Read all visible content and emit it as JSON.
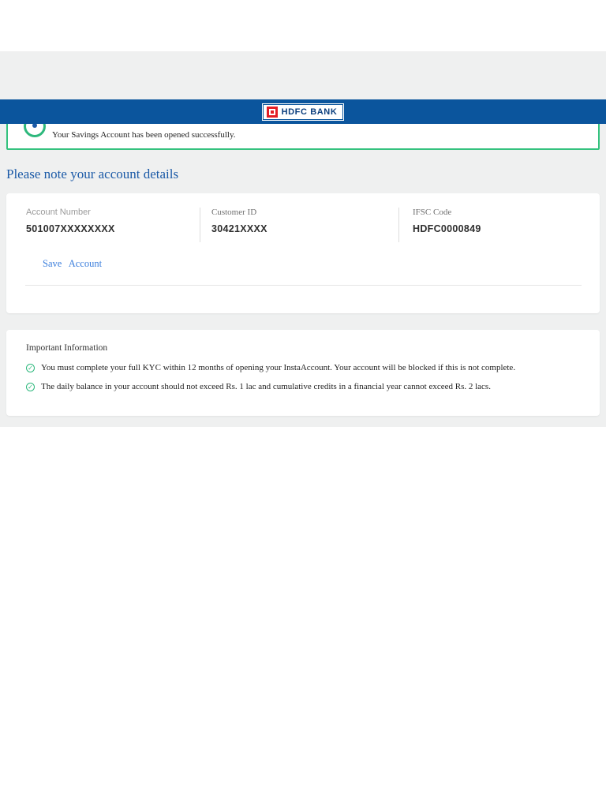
{
  "header": {
    "logo_text": "HDFC BANK"
  },
  "success_banner": {
    "message": "Your Savings Account has been opened successfully."
  },
  "page_title": "Please note your account details",
  "account_details": {
    "fields": [
      {
        "label": "Account Number",
        "value": "501007XXXXXXXX"
      },
      {
        "label": "Customer ID",
        "value": "30421XXXX"
      },
      {
        "label": "IFSC Code",
        "value": "HDFC0000849"
      }
    ],
    "save_link_label": "Save Account"
  },
  "important_information": {
    "title": "Important Information",
    "items": [
      "You must complete your full KYC within 12 months of opening your InstaAccount. Your account will be blocked if this is not complete.",
      "The daily balance in your account should not exceed Rs. 1 lac and cumulative credits in a financial year cannot exceed Rs. 2 lacs."
    ],
    "check_glyph": "✓"
  },
  "colors": {
    "brand_blue": "#0b559d",
    "logo_red": "#e31e26",
    "success_green": "#34c27e",
    "heading_blue": "#1b5aa7",
    "link_blue": "#3b7edc"
  }
}
